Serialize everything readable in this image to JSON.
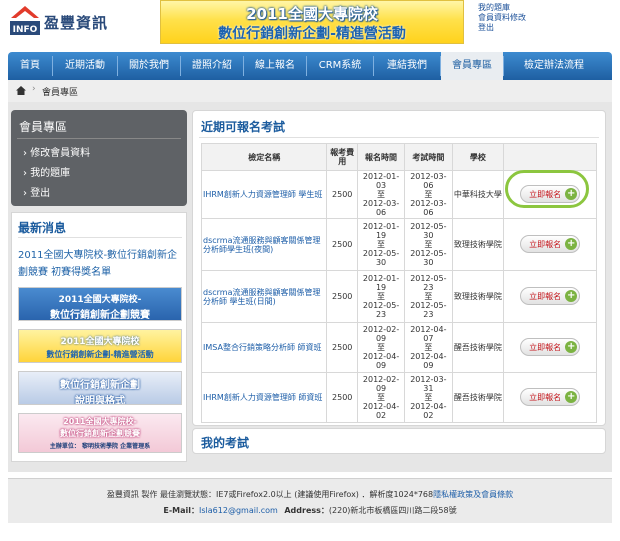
{
  "header": {
    "logo_text": "盈豐資訊",
    "logo_mark_text": "INFO",
    "banner_line1": "2011全國大專院校",
    "banner_line2": "數位行銷創新企劃-精進營活動",
    "top_links": [
      "我的題庫",
      "會員資料修改",
      "登出"
    ]
  },
  "nav": {
    "items": [
      "首頁",
      "近期活動",
      "關於我們",
      "證照介紹",
      "線上報名",
      "CRM系統",
      "連結我們",
      "會員專區",
      "檢定辦法流程"
    ],
    "active": "會員專區"
  },
  "breadcrumb": {
    "label": "會員專區"
  },
  "sidebar": {
    "member_title": "會員專區",
    "member_links": [
      "修改會員資料",
      "我的題庫",
      "登出"
    ],
    "news_title": "最新消息",
    "news_text": "2011全國大專院校-數位行銷創新企劃競賽 初賽得獎名單",
    "news_banners": [
      {
        "line1": "2011全國大專院校-",
        "line2": "數位行銷創新企劃競賽"
      },
      {
        "line1": "2011全國大專院校",
        "line2": "數位行銷創新企劃-精進營活動"
      },
      {
        "line1": "數位行銷創新企劃",
        "line2": "說明與格式"
      },
      {
        "line1": "2011全國大專院校-",
        "line2": "數位行銷創新企劃競賽",
        "line3": "主辦單位：   黎明技術學院 企業管理系"
      }
    ]
  },
  "content": {
    "title": "近期可報名考試",
    "columns": [
      "檢定名稱",
      "報考費用",
      "報名時間",
      "考試時間",
      "學校",
      ""
    ],
    "rows": [
      {
        "name": "IHRM創新人力資源管理師 學生班",
        "fee": "2500",
        "reg": [
          "2012-01-",
          "03",
          "至",
          "2012-03-",
          "06"
        ],
        "exam": [
          "2012-03-",
          "06",
          "至",
          "2012-03-",
          "06"
        ],
        "school": "中華科技大學",
        "button": "立即報名"
      },
      {
        "name": "dscrma流通服務與顧客關係管理分析師學生班(夜間)",
        "fee": "2500",
        "reg": [
          "2012-01-",
          "19",
          "至",
          "2012-05-30"
        ],
        "exam": [
          "2012-05-",
          "30",
          "至",
          "2012-05-",
          "30"
        ],
        "school": "致理技術學院",
        "button": "立即報名"
      },
      {
        "name": "dscrma流通服務與顧客關係管理分析師 學生班(日間)",
        "fee": "2500",
        "reg": [
          "2012-01-",
          "19",
          "至",
          "2012-05-23"
        ],
        "exam": [
          "2012-05-",
          "23",
          "至",
          "2012-05-",
          "23"
        ],
        "school": "致理技術學院",
        "button": "立即報名"
      },
      {
        "name": "IMSA整合行銷策略分析師 師資班",
        "fee": "2500",
        "reg": [
          "2012-02-",
          "09",
          "至",
          "2012-04-",
          "09"
        ],
        "exam": [
          "2012-04-",
          "07",
          "至",
          "2012-04-",
          "09"
        ],
        "school": "醒吾技術學院",
        "button": "立即報名"
      },
      {
        "name": "IHRM創新人力資源管理師 師資班",
        "fee": "2500",
        "reg": [
          "2012-02-",
          "09",
          "至",
          "2012-04-02"
        ],
        "exam": [
          "2012-03-",
          "31",
          "至",
          "2012-04-",
          "02"
        ],
        "school": "醒吾技術學院",
        "button": "立即報名"
      }
    ],
    "my_exam_title": "我的考試"
  },
  "footer": {
    "line1_a": "盈豐資訊 製作 最佳瀏覽狀態：IE7或Firefox2.0以上 (建議使用Firefox) ．解析度1024*768",
    "line1_link": "隱私權政策及會員條款",
    "email_label": "E-Mail：",
    "email": "Isla612@gmail.com",
    "address_label": "Address：",
    "address": "(220)新北市板橋區四川路二段58號"
  },
  "colors": {
    "nav": "#1e5fa2",
    "title_blue": "#1c5c9e",
    "button_plus": "#7cb342",
    "button_text": "#c4161c",
    "highlight": "#8cc63f"
  }
}
